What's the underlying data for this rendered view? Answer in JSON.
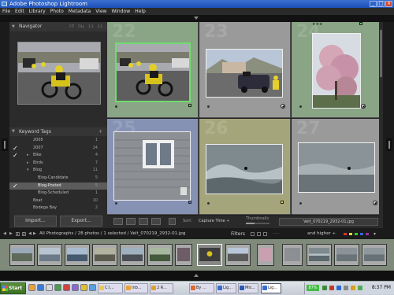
{
  "window": {
    "title": "Adobe Photoshop Lightroom"
  },
  "menu": [
    "File",
    "Edit",
    "Library",
    "Photo",
    "Metadata",
    "View",
    "Window",
    "Help"
  ],
  "navigator": {
    "title": "Navigator",
    "zoom_options": [
      "FIT",
      "FILL",
      "1:1",
      "3:1"
    ]
  },
  "keywords": {
    "title": "Keyword Tags",
    "items": [
      {
        "name": "2005",
        "count": "1",
        "checked": false,
        "indent": false,
        "arrow": ""
      },
      {
        "name": "2007",
        "count": "24",
        "checked": true,
        "indent": false,
        "arrow": ""
      },
      {
        "name": "Bike",
        "count": "4",
        "checked": true,
        "indent": false,
        "arrow": "▸"
      },
      {
        "name": "Birds",
        "count": "7",
        "checked": false,
        "indent": false,
        "arrow": "▸"
      },
      {
        "name": "Blog",
        "count": "11",
        "checked": false,
        "indent": false,
        "arrow": "▾"
      },
      {
        "name": "Blog-Candidate",
        "count": "5",
        "checked": false,
        "indent": true,
        "arrow": ""
      },
      {
        "name": "Blog-Posted",
        "count": "5",
        "checked": true,
        "indent": true,
        "arrow": "",
        "selected": true
      },
      {
        "name": "Blog-Scheduled",
        "count": "1",
        "checked": false,
        "indent": true,
        "arrow": ""
      },
      {
        "name": "Boat",
        "count": "10",
        "checked": false,
        "indent": false,
        "arrow": ""
      },
      {
        "name": "Bodega Bay",
        "count": "2",
        "checked": false,
        "indent": false,
        "arrow": ""
      }
    ]
  },
  "buttons": {
    "import": "Import...",
    "export": "Export..."
  },
  "grid": {
    "cells": [
      {
        "num": "22",
        "stars": ""
      },
      {
        "num": "23",
        "stars": ""
      },
      {
        "num": "24",
        "stars": "★★★"
      },
      {
        "num": "25",
        "stars": ""
      },
      {
        "num": "26",
        "stars": ""
      },
      {
        "num": "27",
        "stars": ""
      }
    ]
  },
  "toolbar": {
    "sort_label": "Sort:",
    "sort_value": "Capture Time ÷",
    "thumbnails_label": "Thumbnails",
    "thumb_size": 0.35,
    "filename": "Velt_070219_2932-01.jpg"
  },
  "filmbar": {
    "page1": "1",
    "page2": "2",
    "path": "All Photographs / 28 photos / 1 selected / Velt_070219_2932-01.jpg",
    "filters": "Filters",
    "rating_filter": "and higher ÷"
  },
  "taskbar": {
    "start": "Start",
    "tasks": [
      "C:\\...",
      "Inb...",
      "2 R...",
      "By ...",
      "Lig...",
      "Mic...",
      "Lig..."
    ],
    "battery": "87%",
    "clock": "8:37 PM"
  },
  "colors": {
    "accent_green": "#7bc47f",
    "cell_green": "#8aa486",
    "cell_blue": "#8692b4",
    "cell_yellow": "#a5a57b",
    "cell_gray": "#9a9a9a"
  }
}
